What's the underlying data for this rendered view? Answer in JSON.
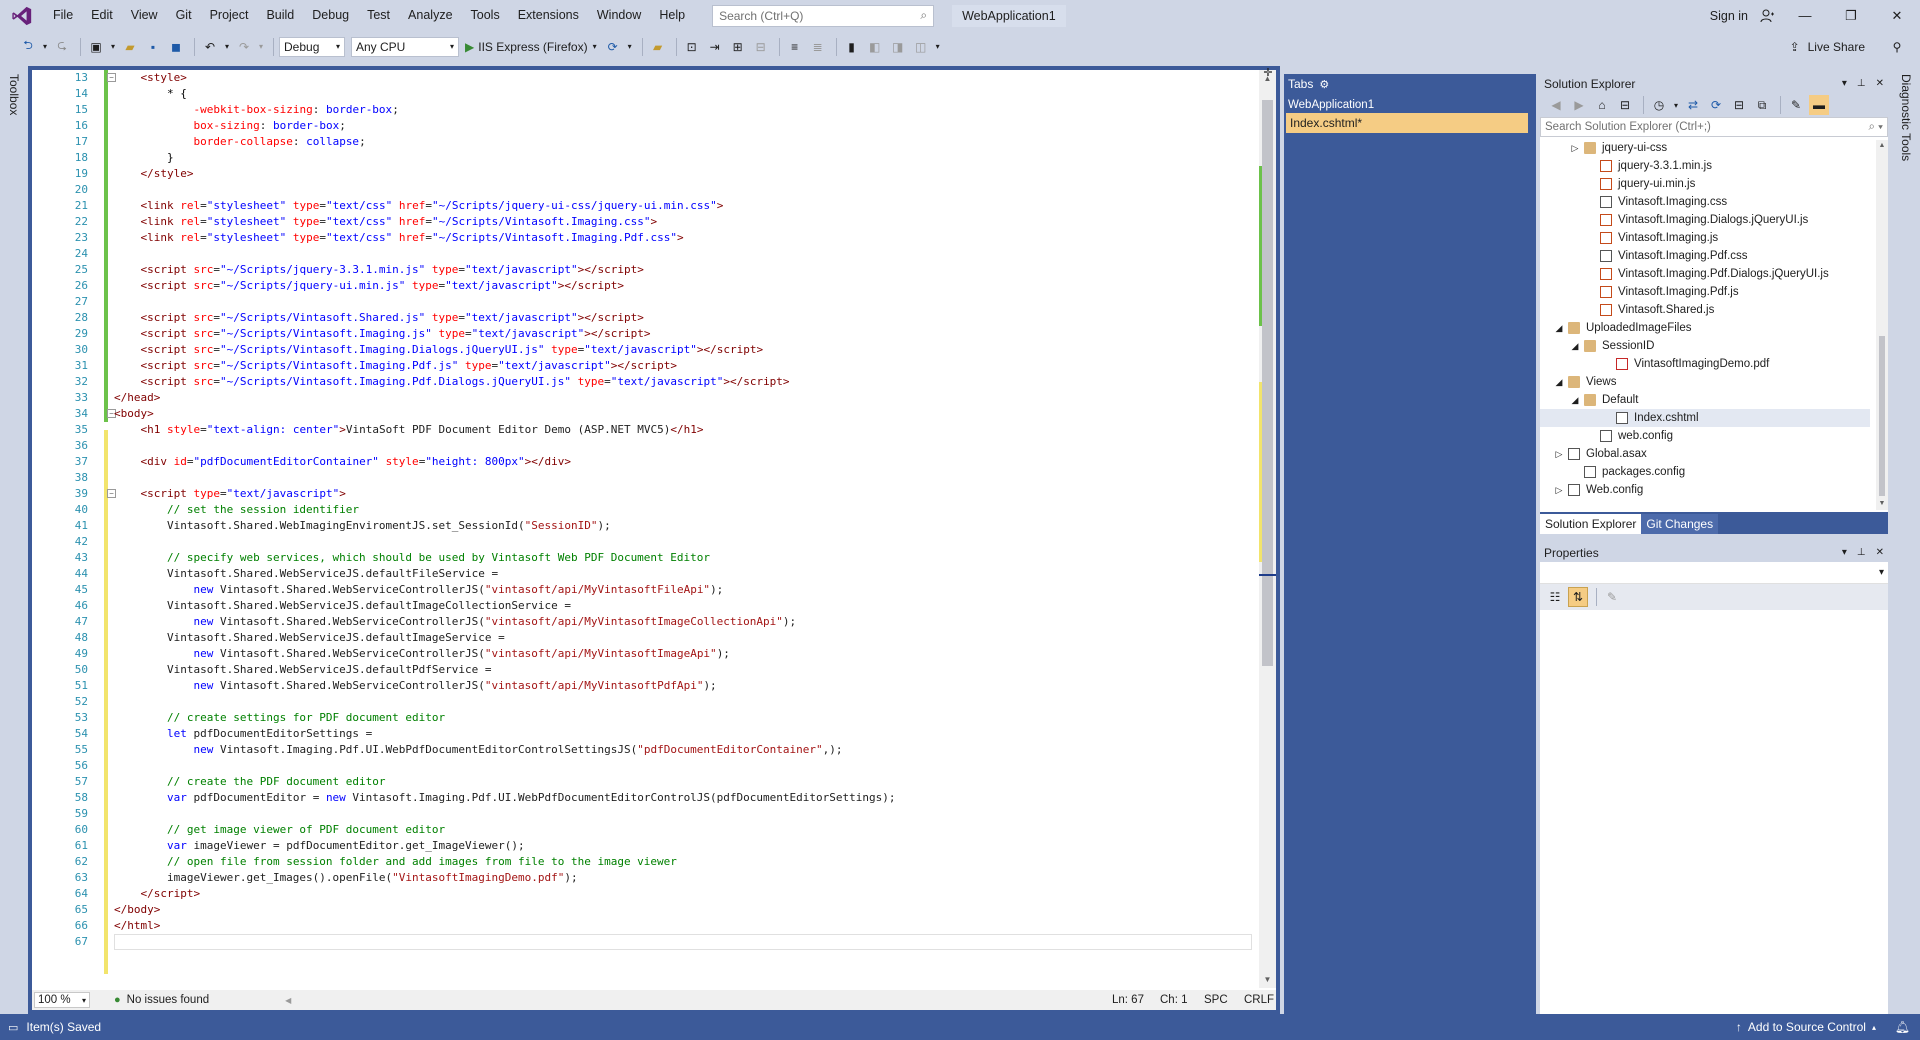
{
  "menu": [
    "File",
    "Edit",
    "View",
    "Git",
    "Project",
    "Build",
    "Debug",
    "Test",
    "Analyze",
    "Tools",
    "Extensions",
    "Window",
    "Help"
  ],
  "search": {
    "placeholder": "Search (Ctrl+Q)"
  },
  "solution_title": "WebApplication1",
  "signin": "Sign in",
  "toolbar": {
    "config": "Debug",
    "platform": "Any CPU",
    "run_target": "IIS Express (Firefox)",
    "live_share": "Live Share"
  },
  "side_labels": {
    "toolbox": "Toolbox",
    "diagnostic": "Diagnostic Tools"
  },
  "editor": {
    "zoom": "100 %",
    "issues": "No issues found",
    "line": "Ln: 67",
    "ch": "Ch: 1",
    "spc": "SPC",
    "crlf": "CRLF",
    "lines": [
      {
        "n": "13",
        "html": "    <span class='tag'>&lt;style&gt;</span>"
      },
      {
        "n": "14",
        "html": "        <span class='txt'>* {</span>"
      },
      {
        "n": "15",
        "html": "            <span class='css-prop'>-webkit-box-sizing</span>: <span class='css-val'>border-box</span>;"
      },
      {
        "n": "16",
        "html": "            <span class='css-prop'>box-sizing</span>: <span class='css-val'>border-box</span>;"
      },
      {
        "n": "17",
        "html": "            <span class='css-prop'>border-collapse</span>: <span class='css-val'>collapse</span>;"
      },
      {
        "n": "18",
        "html": "        <span class='txt'>}</span>"
      },
      {
        "n": "19",
        "html": "    <span class='tag'>&lt;/style&gt;</span>"
      },
      {
        "n": "20",
        "html": ""
      },
      {
        "n": "21",
        "html": "    <span class='tag'>&lt;link</span> <span class='attr'>rel</span>=<span class='val'>\"stylesheet\"</span> <span class='attr'>type</span>=<span class='val'>\"text/css\"</span> <span class='attr'>href</span>=<span class='val'>\"~/Scripts/jquery-ui-css/jquery-ui.min.css\"</span><span class='tag'>&gt;</span>"
      },
      {
        "n": "22",
        "html": "    <span class='tag'>&lt;link</span> <span class='attr'>rel</span>=<span class='val'>\"stylesheet\"</span> <span class='attr'>type</span>=<span class='val'>\"text/css\"</span> <span class='attr'>href</span>=<span class='val'>\"~/Scripts/Vintasoft.Imaging.css\"</span><span class='tag'>&gt;</span>"
      },
      {
        "n": "23",
        "html": "    <span class='tag'>&lt;link</span> <span class='attr'>rel</span>=<span class='val'>\"stylesheet\"</span> <span class='attr'>type</span>=<span class='val'>\"text/css\"</span> <span class='attr'>href</span>=<span class='val'>\"~/Scripts/Vintasoft.Imaging.Pdf.css\"</span><span class='tag'>&gt;</span>"
      },
      {
        "n": "24",
        "html": ""
      },
      {
        "n": "25",
        "html": "    <span class='tag'>&lt;script</span> <span class='attr'>src</span>=<span class='val'>\"~/Scripts/jquery-3.3.1.min.js\"</span> <span class='attr'>type</span>=<span class='val'>\"text/javascript\"</span><span class='tag'>&gt;&lt;/script&gt;</span>"
      },
      {
        "n": "26",
        "html": "    <span class='tag'>&lt;script</span> <span class='attr'>src</span>=<span class='val'>\"~/Scripts/jquery-ui.min.js\"</span> <span class='attr'>type</span>=<span class='val'>\"text/javascript\"</span><span class='tag'>&gt;&lt;/script&gt;</span>"
      },
      {
        "n": "27",
        "html": ""
      },
      {
        "n": "28",
        "html": "    <span class='tag'>&lt;script</span> <span class='attr'>src</span>=<span class='val'>\"~/Scripts/Vintasoft.Shared.js\"</span> <span class='attr'>type</span>=<span class='val'>\"text/javascript\"</span><span class='tag'>&gt;&lt;/script&gt;</span>"
      },
      {
        "n": "29",
        "html": "    <span class='tag'>&lt;script</span> <span class='attr'>src</span>=<span class='val'>\"~/Scripts/Vintasoft.Imaging.js\"</span> <span class='attr'>type</span>=<span class='val'>\"text/javascript\"</span><span class='tag'>&gt;&lt;/script&gt;</span>"
      },
      {
        "n": "30",
        "html": "    <span class='tag'>&lt;script</span> <span class='attr'>src</span>=<span class='val'>\"~/Scripts/Vintasoft.Imaging.Dialogs.jQueryUI.js\"</span> <span class='attr'>type</span>=<span class='val'>\"text/javascript\"</span><span class='tag'>&gt;&lt;/script&gt;</span>"
      },
      {
        "n": "31",
        "html": "    <span class='tag'>&lt;script</span> <span class='attr'>src</span>=<span class='val'>\"~/Scripts/Vintasoft.Imaging.Pdf.js\"</span> <span class='attr'>type</span>=<span class='val'>\"text/javascript\"</span><span class='tag'>&gt;&lt;/script&gt;</span>"
      },
      {
        "n": "32",
        "html": "    <span class='tag'>&lt;script</span> <span class='attr'>src</span>=<span class='val'>\"~/Scripts/Vintasoft.Imaging.Pdf.Dialogs.jQueryUI.js\"</span> <span class='attr'>type</span>=<span class='val'>\"text/javascript\"</span><span class='tag'>&gt;&lt;/script&gt;</span>"
      },
      {
        "n": "33",
        "html": "<span class='tag'>&lt;/head&gt;</span>"
      },
      {
        "n": "34",
        "html": "<span class='tag'>&lt;body&gt;</span>"
      },
      {
        "n": "35",
        "html": "    <span class='tag'>&lt;h1</span> <span class='attr'>style</span>=<span class='val'>\"text-align: center\"</span><span class='tag'>&gt;</span>VintaSoft PDF Document Editor Demo (ASP.NET MVC5)<span class='tag'>&lt;/h1&gt;</span>"
      },
      {
        "n": "36",
        "html": ""
      },
      {
        "n": "37",
        "html": "    <span class='tag'>&lt;div</span> <span class='attr'>id</span>=<span class='val'>\"pdfDocumentEditorContainer\"</span> <span class='attr'>style</span>=<span class='val'>\"height: 800px\"</span><span class='tag'>&gt;&lt;/div&gt;</span>"
      },
      {
        "n": "38",
        "html": ""
      },
      {
        "n": "39",
        "html": "    <span class='tag'>&lt;script</span> <span class='attr'>type</span>=<span class='val'>\"text/javascript\"</span><span class='tag'>&gt;</span>"
      },
      {
        "n": "40",
        "html": "        <span class='cmt'>// set the session identifier</span>"
      },
      {
        "n": "41",
        "html": "        Vintasoft.Shared.WebImagingEnviromentJS.set_SessionId(<span class='str'>\"SessionID\"</span>);"
      },
      {
        "n": "42",
        "html": ""
      },
      {
        "n": "43",
        "html": "        <span class='cmt'>// specify web services, which should be used by Vintasoft Web PDF Document Editor</span>"
      },
      {
        "n": "44",
        "html": "        Vintasoft.Shared.WebServiceJS.defaultFileService ="
      },
      {
        "n": "45",
        "html": "            <span class='kw'>new</span> Vintasoft.Shared.WebServiceControllerJS(<span class='str'>\"vintasoft/api/MyVintasoftFileApi\"</span>);"
      },
      {
        "n": "46",
        "html": "        Vintasoft.Shared.WebServiceJS.defaultImageCollectionService ="
      },
      {
        "n": "47",
        "html": "            <span class='kw'>new</span> Vintasoft.Shared.WebServiceControllerJS(<span class='str'>\"vintasoft/api/MyVintasoftImageCollectionApi\"</span>);"
      },
      {
        "n": "48",
        "html": "        Vintasoft.Shared.WebServiceJS.defaultImageService ="
      },
      {
        "n": "49",
        "html": "            <span class='kw'>new</span> Vintasoft.Shared.WebServiceControllerJS(<span class='str'>\"vintasoft/api/MyVintasoftImageApi\"</span>);"
      },
      {
        "n": "50",
        "html": "        Vintasoft.Shared.WebServiceJS.defaultPdfService ="
      },
      {
        "n": "51",
        "html": "            <span class='kw'>new</span> Vintasoft.Shared.WebServiceControllerJS(<span class='str'>\"vintasoft/api/MyVintasoftPdfApi\"</span>);"
      },
      {
        "n": "52",
        "html": ""
      },
      {
        "n": "53",
        "html": "        <span class='cmt'>// create settings for PDF document editor</span>"
      },
      {
        "n": "54",
        "html": "        <span class='kw'>let</span> pdfDocumentEditorSettings ="
      },
      {
        "n": "55",
        "html": "            <span class='kw'>new</span> Vintasoft.Imaging.Pdf.UI.WebPdfDocumentEditorControlSettingsJS(<span class='str'>\"pdfDocumentEditorContainer\"</span>,);"
      },
      {
        "n": "56",
        "html": ""
      },
      {
        "n": "57",
        "html": "        <span class='cmt'>// create the PDF document editor</span>"
      },
      {
        "n": "58",
        "html": "        <span class='kw'>var</span> pdfDocumentEditor = <span class='kw'>new</span> Vintasoft.Imaging.Pdf.UI.WebPdfDocumentEditorControlJS(pdfDocumentEditorSettings);"
      },
      {
        "n": "59",
        "html": ""
      },
      {
        "n": "60",
        "html": "        <span class='cmt'>// get image viewer of PDF document editor</span>"
      },
      {
        "n": "61",
        "html": "        <span class='kw'>var</span> imageViewer = pdfDocumentEditor.get_ImageViewer();"
      },
      {
        "n": "62",
        "html": "        <span class='cmt'>// open file from session folder and add images from file to the image viewer</span>"
      },
      {
        "n": "63",
        "html": "        imageViewer.get_Images().openFile(<span class='str'>\"VintasoftImagingDemo.pdf\"</span>);"
      },
      {
        "n": "64",
        "html": "    <span class='tag'>&lt;/script&gt;</span>"
      },
      {
        "n": "65",
        "html": "<span class='tag'>&lt;/body&gt;</span>"
      },
      {
        "n": "66",
        "html": "<span class='tag'>&lt;/html&gt;</span>"
      },
      {
        "n": "67",
        "html": ""
      }
    ]
  },
  "tabs_panel": {
    "title": "Tabs",
    "project": "WebApplication1",
    "file": "Index.cshtml*"
  },
  "solution_explorer": {
    "title": "Solution Explorer",
    "search_placeholder": "Search Solution Explorer (Ctrl+;)",
    "items": [
      {
        "label": "jquery-ui-css",
        "icon": "folder-icon",
        "indent": 3,
        "expander": "collapsed"
      },
      {
        "label": "jquery-3.3.1.min.js",
        "icon": "js-file-icon",
        "indent": 4,
        "expander": ""
      },
      {
        "label": "jquery-ui.min.js",
        "icon": "js-file-icon",
        "indent": 4,
        "expander": ""
      },
      {
        "label": "Vintasoft.Imaging.css",
        "icon": "css-file-icon",
        "indent": 4,
        "expander": ""
      },
      {
        "label": "Vintasoft.Imaging.Dialogs.jQueryUI.js",
        "icon": "js-file-icon",
        "indent": 4,
        "expander": ""
      },
      {
        "label": "Vintasoft.Imaging.js",
        "icon": "js-file-icon",
        "indent": 4,
        "expander": ""
      },
      {
        "label": "Vintasoft.Imaging.Pdf.css",
        "icon": "css-file-icon",
        "indent": 4,
        "expander": ""
      },
      {
        "label": "Vintasoft.Imaging.Pdf.Dialogs.jQueryUI.js",
        "icon": "js-file-icon",
        "indent": 4,
        "expander": ""
      },
      {
        "label": "Vintasoft.Imaging.Pdf.js",
        "icon": "js-file-icon",
        "indent": 4,
        "expander": ""
      },
      {
        "label": "Vintasoft.Shared.js",
        "icon": "js-file-icon",
        "indent": 4,
        "expander": ""
      },
      {
        "label": "UploadedImageFiles",
        "icon": "folder-icon",
        "indent": 2,
        "expander": "expanded"
      },
      {
        "label": "SessionID",
        "icon": "folder-icon",
        "indent": 3,
        "expander": "expanded"
      },
      {
        "label": "VintasoftImagingDemo.pdf",
        "icon": "pdf-file-icon",
        "indent": 5,
        "expander": ""
      },
      {
        "label": "Views",
        "icon": "folder-icon",
        "indent": 2,
        "expander": "expanded"
      },
      {
        "label": "Default",
        "icon": "folder-icon",
        "indent": 3,
        "expander": "expanded"
      },
      {
        "label": "Index.cshtml",
        "icon": "cshtml-file-icon",
        "indent": 5,
        "expander": "",
        "selected": true
      },
      {
        "label": "web.config",
        "icon": "config-file-icon",
        "indent": 4,
        "expander": ""
      },
      {
        "label": "Global.asax",
        "icon": "asax-file-icon",
        "indent": 2,
        "expander": "collapsed"
      },
      {
        "label": "packages.config",
        "icon": "config-file-icon",
        "indent": 3,
        "expander": ""
      },
      {
        "label": "Web.config",
        "icon": "config-file-icon",
        "indent": 2,
        "expander": "collapsed"
      }
    ],
    "tabs": [
      "Solution Explorer",
      "Git Changes"
    ]
  },
  "properties": {
    "title": "Properties"
  },
  "statusbar": {
    "saved": "Item(s) Saved",
    "source_control": "Add to Source Control"
  },
  "colors": {
    "accent": "#3c5a99",
    "chrome": "#cfd6e5",
    "active_tab": "#f5cc84",
    "vs_purple": "#68217a"
  }
}
